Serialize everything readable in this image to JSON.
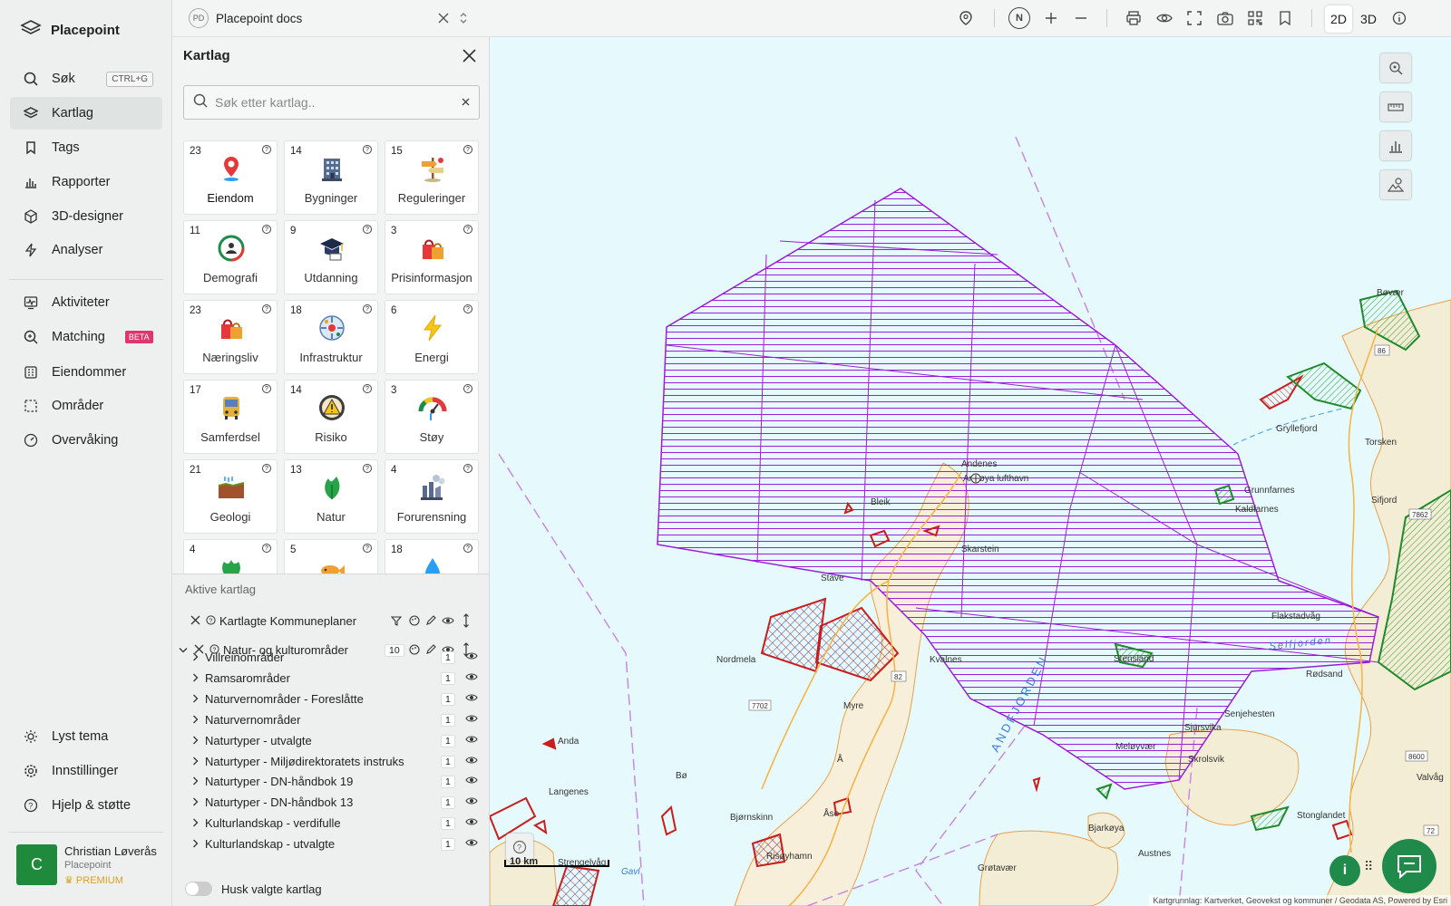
{
  "nav": {
    "brand": "Placepoint",
    "items": [
      {
        "label": "Søk",
        "shortcut": "CTRL+G"
      },
      {
        "label": "Kartlag"
      },
      {
        "label": "Tags"
      },
      {
        "label": "Rapporter"
      },
      {
        "label": "3D-designer"
      },
      {
        "label": "Analyser"
      },
      {
        "label": "Aktiviteter"
      },
      {
        "label": "Matching",
        "badge": "BETA"
      },
      {
        "label": "Eiendommer"
      },
      {
        "label": "Områder"
      },
      {
        "label": "Overvåking"
      }
    ],
    "bottom": [
      {
        "label": "Lyst tema"
      },
      {
        "label": "Innstillinger"
      },
      {
        "label": "Hjelp & støtte"
      }
    ],
    "user": {
      "initial": "C",
      "name": "Christian Løverås",
      "org": "Placepoint",
      "plan": "PREMIUM"
    }
  },
  "topbar": {
    "doc_badge": "PD",
    "doc_title": "Placepoint docs",
    "compass": "N",
    "mode_2d": "2D",
    "mode_3d": "3D"
  },
  "panel": {
    "title": "Kartlag",
    "search_placeholder": "Søk etter kartlag..",
    "tiles": [
      {
        "count": "23",
        "label": "Eiendom"
      },
      {
        "count": "14",
        "label": "Bygninger"
      },
      {
        "count": "15",
        "label": "Reguleringer"
      },
      {
        "count": "11",
        "label": "Demografi"
      },
      {
        "count": "9",
        "label": "Utdanning"
      },
      {
        "count": "3",
        "label": "Prisinformasjon"
      },
      {
        "count": "23",
        "label": "Næringsliv"
      },
      {
        "count": "18",
        "label": "Infrastruktur"
      },
      {
        "count": "6",
        "label": "Energi"
      },
      {
        "count": "17",
        "label": "Samferdsel"
      },
      {
        "count": "14",
        "label": "Risiko"
      },
      {
        "count": "3",
        "label": "Støy"
      },
      {
        "count": "21",
        "label": "Geologi"
      },
      {
        "count": "13",
        "label": "Natur"
      },
      {
        "count": "4",
        "label": "Forurensning"
      },
      {
        "count": "4",
        "label": ""
      },
      {
        "count": "5",
        "label": ""
      },
      {
        "count": "18",
        "label": ""
      }
    ],
    "active_header": "Aktive kartlag",
    "layer1": "Kartlagte Kommuneplaner",
    "layer2": {
      "name": "Natur- og kulturområder",
      "count": "10"
    },
    "sublayers": [
      {
        "name": "Villreinområder",
        "count": "1"
      },
      {
        "name": "Ramsarområder",
        "count": "1"
      },
      {
        "name": "Naturvernområder - Foreslåtte",
        "count": "1"
      },
      {
        "name": "Naturvernområder",
        "count": "1"
      },
      {
        "name": "Naturtyper - utvalgte",
        "count": "1"
      },
      {
        "name": "Naturtyper - Miljødirektoratets instruks",
        "count": "1"
      },
      {
        "name": "Naturtyper - DN-håndbok 19",
        "count": "1"
      },
      {
        "name": "Naturtyper - DN-håndbok 13",
        "count": "1"
      },
      {
        "name": "Kulturlandskap - verdifulle",
        "count": "1"
      },
      {
        "name": "Kulturlandskap - utvalgte",
        "count": "1"
      }
    ],
    "remember": "Husk valgte kartlag"
  },
  "map": {
    "scale": "10 km",
    "attribution": "Kartgrunnlag: Kartverket, Geovekst og kommuner / Geodata AS, Powered by Esri",
    "places": [
      "Andenes",
      "Andøya lufthavn",
      "Bleik",
      "Skarstein",
      "Stave",
      "Nordmela",
      "Kvalnes",
      "Myre",
      "Å",
      "Bø",
      "Anda",
      "Langenes",
      "Bjørnskinn",
      "Åse",
      "Risøyhamn",
      "Strengelvåg",
      "Gavl",
      "Bjarkøya",
      "Austnes",
      "Grøtavær",
      "Senjehesten",
      "Skrolsvik",
      "Meløyvær",
      "Stonglandet",
      "Rødsand",
      "Flakstadvåg",
      "Kaldfarnes",
      "Grunnfarnes",
      "Torsken",
      "Gryllefjord",
      "Bøvær",
      "Sifjord",
      "Valvåg",
      "Sjursvika",
      "Stensland",
      "ANDFJORDEN",
      "Selfjorden"
    ],
    "roads": [
      "82",
      "7702",
      "86",
      "7862",
      "8600",
      "72"
    ]
  }
}
